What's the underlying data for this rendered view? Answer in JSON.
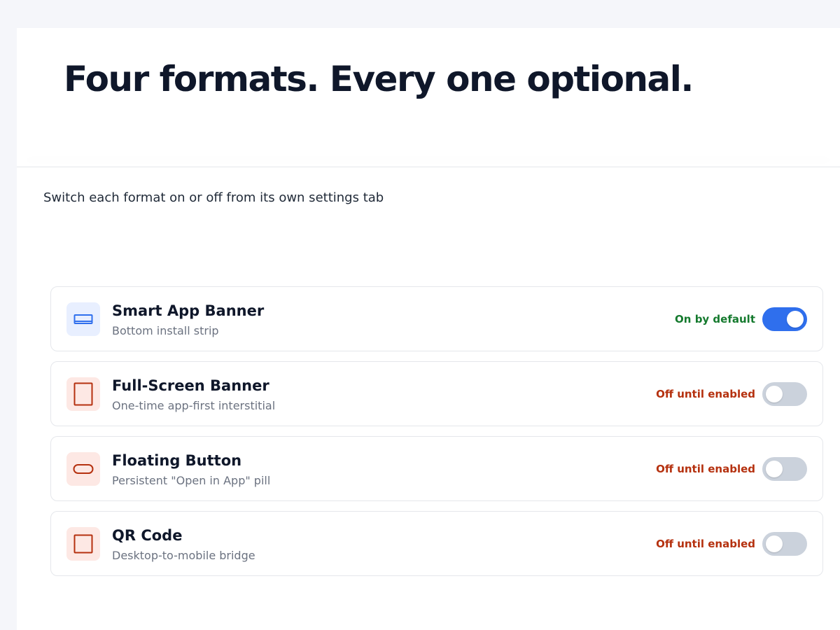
{
  "hero": {
    "headline": "Four formats. Every one optional."
  },
  "intro": {
    "subtitle": "Switch each format on or off from its own settings tab"
  },
  "colors": {
    "on_accent": "#2f6fed",
    "on_status": "#157a2e",
    "off_status": "#b5310f",
    "off_track": "#cbd2dc",
    "on_icon_bg": "#e8efff",
    "off_icon_bg": "#fde8e4"
  },
  "formats": [
    {
      "title": "Smart App Banner",
      "description": "Bottom install strip",
      "status": "On by default",
      "enabled": true,
      "icon": "banner-strip-icon"
    },
    {
      "title": "Full-Screen Banner",
      "description": "One-time app-first interstitial",
      "status": "Off until enabled",
      "enabled": false,
      "icon": "full-screen-icon"
    },
    {
      "title": "Floating Button",
      "description": "Persistent \"Open in App\" pill",
      "status": "Off until enabled",
      "enabled": false,
      "icon": "pill-button-icon"
    },
    {
      "title": "QR Code",
      "description": "Desktop-to-mobile bridge",
      "status": "Off until enabled",
      "enabled": false,
      "icon": "qr-square-icon"
    }
  ]
}
